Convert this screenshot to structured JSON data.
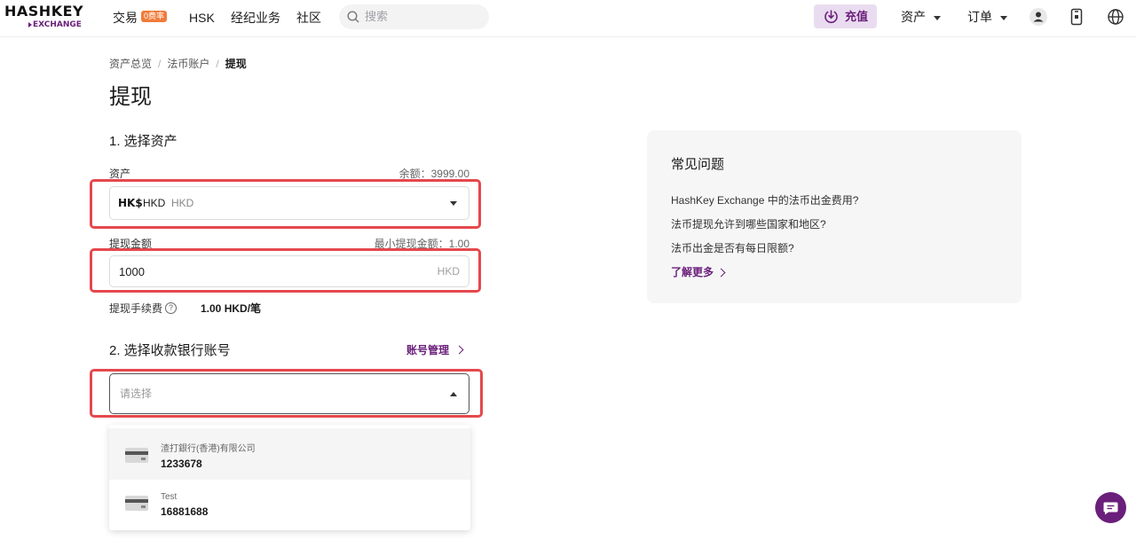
{
  "header": {
    "logo_top": "HASHKEY",
    "logo_bottom": "EXCHANGE",
    "nav": {
      "trade": "交易",
      "trade_badge": "0费率",
      "hsk": "HSK",
      "brokerage": "经纪业务",
      "community": "社区"
    },
    "search_placeholder": "搜索",
    "recharge_label": "充值",
    "assets_label": "资产",
    "orders_label": "订单"
  },
  "breadcrumb": [
    "资产总览",
    "法币账户",
    "提现"
  ],
  "page_title": "提现",
  "step1": {
    "title": "1. 选择资产",
    "asset_label": "资产",
    "balance": "余额：3999.00",
    "asset_mark": "HK$",
    "asset_code": "HKD",
    "asset_name": "HKD",
    "amount_label": "提现金额",
    "min_amount": "最小提现金额：1.00",
    "amount_value": "1000",
    "amount_unit": "HKD",
    "fee_label": "提现手续费",
    "fee_help": "?",
    "fee_value": "1.00 HKD/笔"
  },
  "step2": {
    "title": "2. 选择收款银行账号",
    "manage_link": "账号管理",
    "placeholder": "请选择",
    "accounts": [
      {
        "bank": "渣打銀行(香港)有限公司",
        "number": "1233678"
      },
      {
        "bank": "Test",
        "number": "16881688"
      }
    ]
  },
  "faq": {
    "title": "常见问题",
    "questions": [
      "HashKey Exchange 中的法币出金费用?",
      "法币提现允许到哪些国家和地区?",
      "法币出金是否有每日限额?"
    ],
    "more": "了解更多"
  },
  "colors": {
    "brand": "#6a1f7a",
    "highlight": "#e5484d",
    "badge": "#f07c3a"
  }
}
